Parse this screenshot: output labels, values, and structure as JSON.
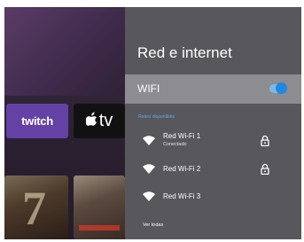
{
  "background": {
    "apps": [
      {
        "id": "twitch",
        "label": "twitch",
        "color": "#6441a5"
      },
      {
        "id": "appletv",
        "mark": "",
        "label": "tv",
        "color": "#111111"
      }
    ],
    "posters": [
      {
        "number": "7"
      },
      {
        "number": ""
      }
    ]
  },
  "panel": {
    "title": "Red e internet",
    "wifi": {
      "label": "WIFI",
      "enabled": true
    },
    "section_label": "Redes disponibles",
    "networks": [
      {
        "name": "Red Wi-Fi 1",
        "status": "Conectado",
        "locked": true,
        "icon": "wifi-icon"
      },
      {
        "name": "Red Wi-Fi 2",
        "status": "",
        "locked": true,
        "icon": "wifi-icon"
      },
      {
        "name": "Red Wi-Fi 3",
        "status": "",
        "locked": false,
        "icon": "wifi-icon"
      }
    ],
    "see_all": "Ver todas"
  },
  "colors": {
    "panel_bg": "#58575c",
    "selected_row": "#8d8c91",
    "accent": "#1e88e5",
    "section_label": "#5fa8e8"
  }
}
